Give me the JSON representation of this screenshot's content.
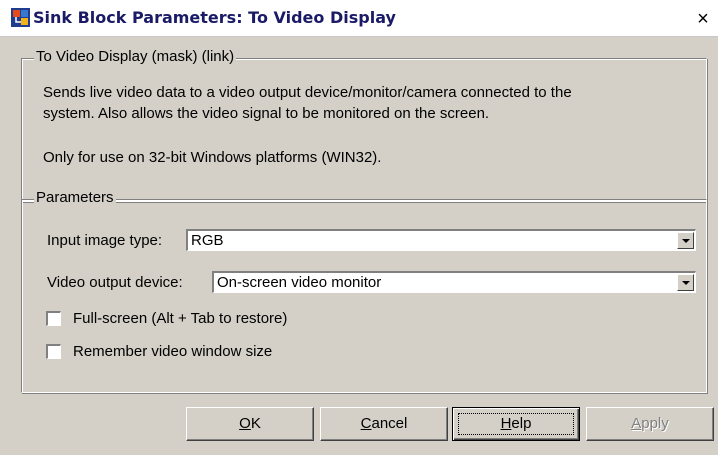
{
  "window": {
    "title": "Sink Block Parameters: To Video Display",
    "close_glyph": "×"
  },
  "description_group": {
    "legend": "To Video Display (mask) (link)",
    "line1": "Sends live video data to a video output device/monitor/camera connected to the",
    "line2": "system.  Also allows the video signal to be monitored on the screen.",
    "line3": "Only for use on 32-bit Windows platforms (WIN32)."
  },
  "parameters_group": {
    "legend": "Parameters",
    "input_image_type": {
      "label": "Input image type:",
      "value": "RGB"
    },
    "video_output_device": {
      "label": "Video output device:",
      "value": "On-screen video monitor"
    },
    "full_screen": {
      "label": "Full-screen (Alt + Tab to restore)",
      "checked": false
    },
    "remember_size": {
      "label": "Remember video window size",
      "checked": false
    }
  },
  "buttons": {
    "ok": {
      "accel": "O",
      "rest": "K"
    },
    "cancel": {
      "accel": "C",
      "rest": "ancel"
    },
    "help": {
      "accel": "H",
      "rest": "elp"
    },
    "apply": {
      "accel": "A",
      "rest": "pply"
    }
  },
  "icons": {
    "title_icon": "simulink-block-icon",
    "dropdown_arrow": "chevron-down-icon"
  }
}
